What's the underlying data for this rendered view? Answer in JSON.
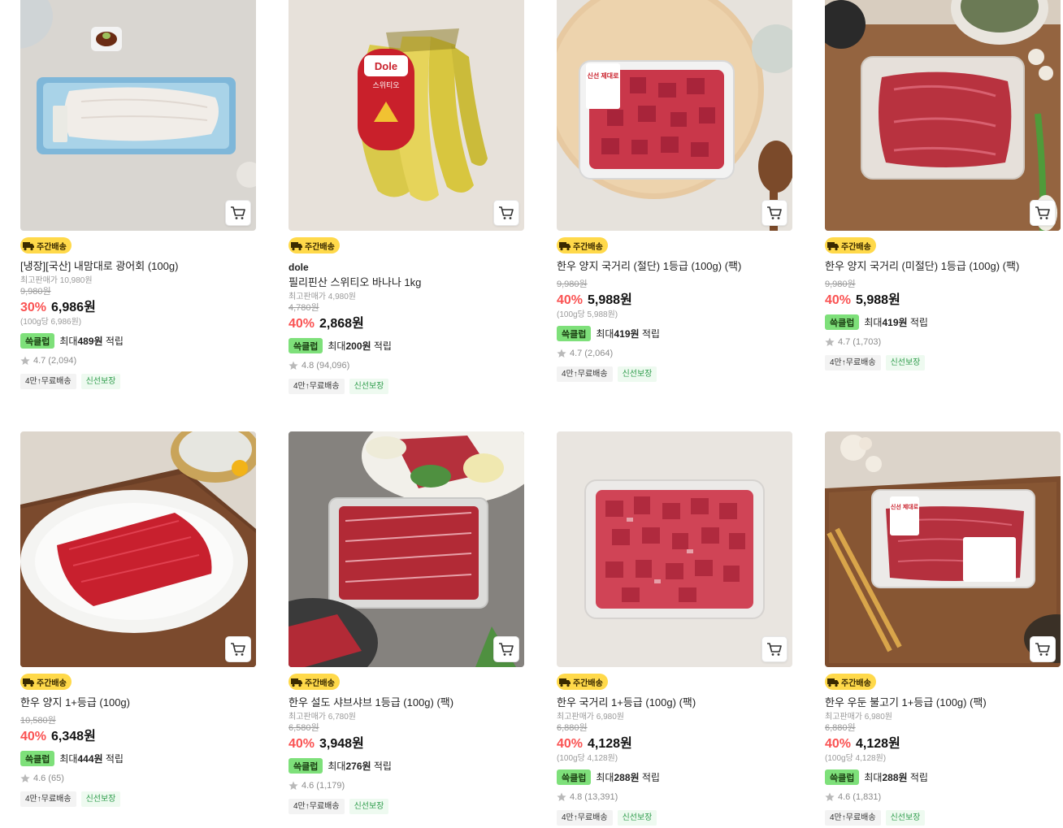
{
  "products": [
    {
      "delivery_badge": "주간배송",
      "brand": "",
      "name": "[냉장][국산] 내맘대로 광어회 (100g)",
      "max_price": "최고판매가 10,980원",
      "original_price": "9,980원",
      "discount": "30%",
      "price": "6,986원",
      "unit_price": "(100g당 6,986원)",
      "points_badge": "쓱클럽",
      "points_prefix": "최대",
      "points_amount": "489원",
      "points_suffix": "적립",
      "rating": "4.7",
      "reviews": "(2,094)",
      "tag_ship": "4만↑무료배송",
      "tag_fresh": "신선보장",
      "image": "flounder-sashimi"
    },
    {
      "delivery_badge": "주간배송",
      "brand": "dole",
      "name": "필리핀산 스위티오 바나나 1kg",
      "max_price": "최고판매가 4,980원",
      "original_price": "4,780원",
      "discount": "40%",
      "price": "2,868원",
      "unit_price": "",
      "points_badge": "쓱클럽",
      "points_prefix": "최대",
      "points_amount": "200원",
      "points_suffix": "적립",
      "rating": "4.8",
      "reviews": "(94,096)",
      "tag_ship": "4만↑무료배송",
      "tag_fresh": "신선보장",
      "image": "banana"
    },
    {
      "delivery_badge": "주간배송",
      "brand": "",
      "name": "한우 양지 국거리 (절단) 1등급 (100g) (팩)",
      "max_price": "",
      "original_price": "9,980원",
      "discount": "40%",
      "price": "5,988원",
      "unit_price": "(100g당 5,988원)",
      "points_badge": "쓱클럽",
      "points_prefix": "최대",
      "points_amount": "419원",
      "points_suffix": "적립",
      "rating": "4.7",
      "reviews": "(2,064)",
      "tag_ship": "4만↑무료배송",
      "tag_fresh": "신선보장",
      "image": "beef-cubes-pack"
    },
    {
      "delivery_badge": "주간배송",
      "brand": "",
      "name": "한우 양지 국거리 (미절단) 1등급 (100g) (팩)",
      "max_price": "",
      "original_price": "9,980원",
      "discount": "40%",
      "price": "5,988원",
      "unit_price": "",
      "points_badge": "쓱클럽",
      "points_prefix": "최대",
      "points_amount": "419원",
      "points_suffix": "적립",
      "rating": "4.7",
      "reviews": "(1,703)",
      "tag_ship": "4만↑무료배송",
      "tag_fresh": "신선보장",
      "image": "beef-slab-pack"
    },
    {
      "delivery_badge": "주간배송",
      "brand": "",
      "name": "한우 양지 1+등급 (100g)",
      "max_price": "",
      "original_price": "10,580원",
      "discount": "40%",
      "price": "6,348원",
      "unit_price": "",
      "points_badge": "쓱클럽",
      "points_prefix": "최대",
      "points_amount": "444원",
      "points_suffix": "적립",
      "rating": "4.6",
      "reviews": "(65)",
      "tag_ship": "4만↑무료배송",
      "tag_fresh": "신선보장",
      "image": "beef-brisket-plate"
    },
    {
      "delivery_badge": "주간배송",
      "brand": "",
      "name": "한우 설도 샤브샤브 1등급 (100g) (팩)",
      "max_price": "최고판매가 6,780원",
      "original_price": "6,580원",
      "discount": "40%",
      "price": "3,948원",
      "unit_price": "",
      "points_badge": "쓱클럽",
      "points_prefix": "최대",
      "points_amount": "276원",
      "points_suffix": "적립",
      "rating": "4.6",
      "reviews": "(1,179)",
      "tag_ship": "4만↑무료배송",
      "tag_fresh": "신선보장",
      "image": "beef-shabu-pack"
    },
    {
      "delivery_badge": "주간배송",
      "brand": "",
      "name": "한우 국거리 1+등급 (100g) (팩)",
      "max_price": "최고판매가 6,980원",
      "original_price": "6,880원",
      "discount": "40%",
      "price": "4,128원",
      "unit_price": "(100g당 4,128원)",
      "points_badge": "쓱클럽",
      "points_prefix": "최대",
      "points_amount": "288원",
      "points_suffix": "적립",
      "rating": "4.8",
      "reviews": "(13,391)",
      "tag_ship": "4만↑무료배송",
      "tag_fresh": "신선보장",
      "image": "beef-soup-cubes-pack"
    },
    {
      "delivery_badge": "주간배송",
      "brand": "",
      "name": "한우 우둔 불고기 1+등급 (100g) (팩)",
      "max_price": "최고판매가 6,980원",
      "original_price": "6,880원",
      "discount": "40%",
      "price": "4,128원",
      "unit_price": "(100g당 4,128원)",
      "points_badge": "쓱클럽",
      "points_prefix": "최대",
      "points_amount": "288원",
      "points_suffix": "적립",
      "rating": "4.6",
      "reviews": "(1,831)",
      "tag_ship": "4만↑무료배송",
      "tag_fresh": "신선보장",
      "image": "beef-bulgogi-pack"
    }
  ],
  "pack_label": "신선\n제대로",
  "banana_label": "스위티오",
  "banana_brand": "Dole",
  "colors": {
    "discount": "#fa5252",
    "delivery_badge": "#ffd94a",
    "points_badge": "#7ee07a",
    "fresh_tag": "#2e9c4b"
  }
}
